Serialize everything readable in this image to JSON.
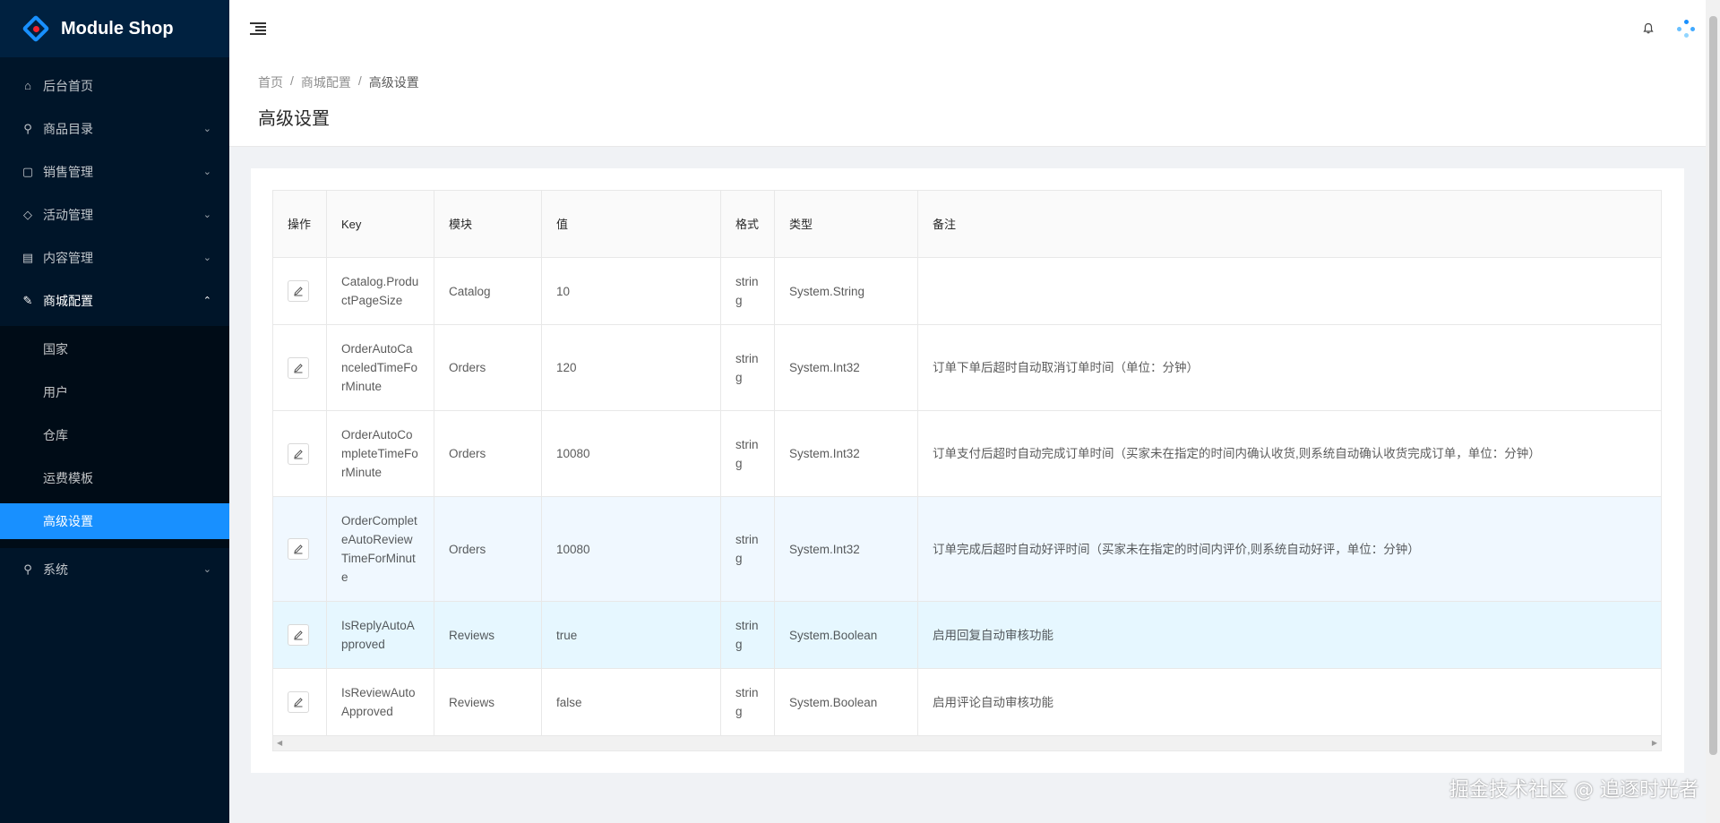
{
  "app": {
    "title": "Module Shop"
  },
  "sidebar": {
    "items": [
      {
        "label": "后台首页",
        "icon": "home-icon",
        "has_arrow": false
      },
      {
        "label": "商品目录",
        "icon": "cluster-icon",
        "has_arrow": true
      },
      {
        "label": "销售管理",
        "icon": "shopping-icon",
        "has_arrow": true
      },
      {
        "label": "活动管理",
        "icon": "tag-icon",
        "has_arrow": true
      },
      {
        "label": "内容管理",
        "icon": "profile-icon",
        "has_arrow": true
      },
      {
        "label": "商城配置",
        "icon": "tool-icon",
        "has_arrow": true,
        "open": true
      },
      {
        "label": "系统",
        "icon": "cluster-icon",
        "has_arrow": true
      }
    ],
    "subitems": [
      {
        "label": "国家"
      },
      {
        "label": "用户"
      },
      {
        "label": "仓库"
      },
      {
        "label": "运费模板"
      },
      {
        "label": "高级设置",
        "active": true
      }
    ],
    "accent": "#1890ff",
    "background": "#001529"
  },
  "breadcrumb": [
    "首页",
    "商城配置",
    "高级设置"
  ],
  "page": {
    "title": "高级设置"
  },
  "table": {
    "columns": [
      "操作",
      "Key",
      "模块",
      "值",
      "格式",
      "类型",
      "备注"
    ],
    "rows": [
      {
        "key": "Catalog.ProductPageSize",
        "module": "Catalog",
        "value": "10",
        "format": "string",
        "type": "System.String",
        "note": ""
      },
      {
        "key": "OrderAutoCanceledTimeForMinute",
        "module": "Orders",
        "value": "120",
        "format": "string",
        "type": "System.Int32",
        "note": "订单下单后超时自动取消订单时间（单位：分钟）"
      },
      {
        "key": "OrderAutoCompleteTimeForMinute",
        "module": "Orders",
        "value": "10080",
        "format": "string",
        "type": "System.Int32",
        "note": "订单支付后超时自动完成订单时间（买家未在指定的时间内确认收货,则系统自动确认收货完成订单，单位：分钟）"
      },
      {
        "key": "OrderCompleteAutoReviewTimeForMinute",
        "module": "Orders",
        "value": "10080",
        "format": "string",
        "type": "System.Int32",
        "note": "订单完成后超时自动好评时间（买家未在指定的时间内评价,则系统自动好评，单位：分钟）"
      },
      {
        "key": "IsReplyAutoApproved",
        "module": "Reviews",
        "value": "true",
        "format": "string",
        "type": "System.Boolean",
        "note": "启用回复自动审核功能"
      },
      {
        "key": "IsReviewAutoApproved",
        "module": "Reviews",
        "value": "false",
        "format": "string",
        "type": "System.Boolean",
        "note": "启用评论自动审核功能"
      }
    ]
  },
  "watermark": "掘金技术社区 @ 追逐时光者"
}
